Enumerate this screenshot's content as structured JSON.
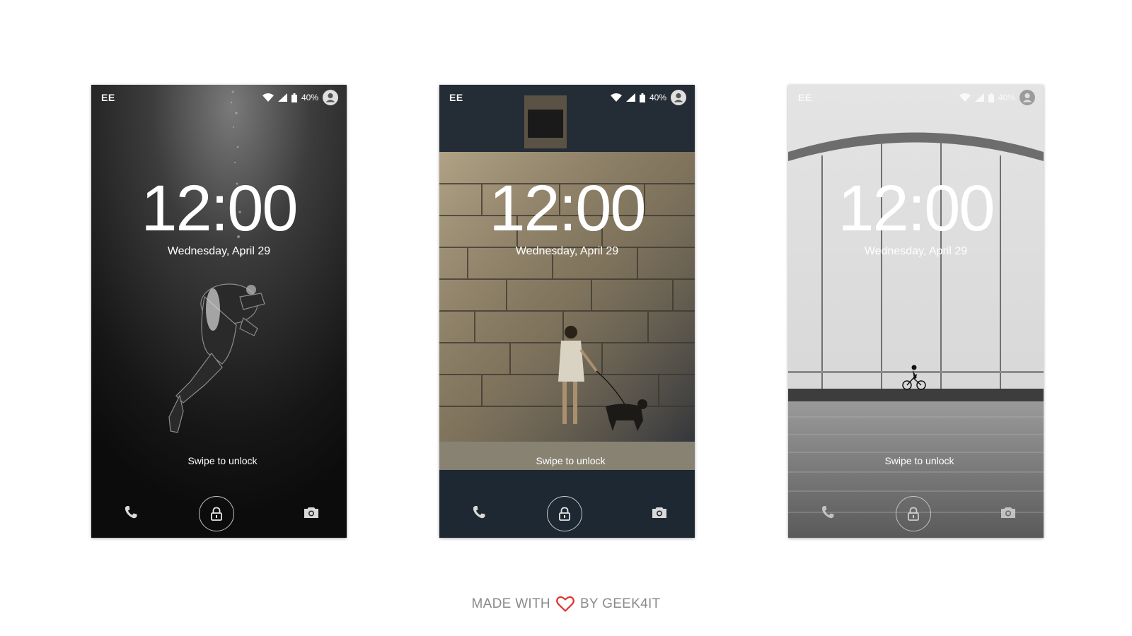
{
  "phones": [
    {
      "carrier": "EE",
      "battery": "40%",
      "time": "12:00",
      "date": "Wednesday, April 29",
      "swipe": "Swipe to unlock",
      "wallpaper": "scuba-diver-underwater"
    },
    {
      "carrier": "EE",
      "battery": "40%",
      "time": "12:00",
      "date": "Wednesday, April 29",
      "swipe": "Swipe to unlock",
      "wallpaper": "woman-with-dog-by-stone-wall"
    },
    {
      "carrier": "EE",
      "battery": "40%",
      "time": "12:00",
      "date": "Wednesday, April 29",
      "swipe": "Swipe to unlock",
      "wallpaper": "cyclist-on-bridge-over-water"
    }
  ],
  "footer": {
    "made_with": "MADE WITH",
    "by": "BY GEEK4IT"
  },
  "colors": {
    "heart": "#e0312e",
    "footer_text": "#8a8a8a"
  }
}
